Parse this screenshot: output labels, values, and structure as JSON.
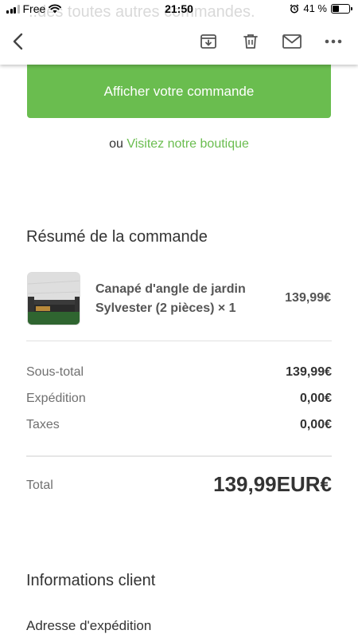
{
  "status_bar": {
    "carrier": "Free",
    "time": "21:50",
    "battery": "41 %",
    "battery_level": 0.41,
    "ghost_text": "..des toutes autres commandes."
  },
  "toolbar": {
    "back_icon": "chevron-left-icon",
    "archive_icon": "archive-icon",
    "delete_icon": "trash-icon",
    "mail_icon": "envelope-icon",
    "more_icon": "more-horizontal-icon"
  },
  "order": {
    "view_button": "Afficher votre commande",
    "or_text": "ou",
    "shop_link": "Visitez notre boutique"
  },
  "summary": {
    "title": "Résumé de la commande",
    "item": {
      "name": "Canapé d'angle de jardin Sylvester (2 pièces) × 1",
      "price": "139,99€"
    },
    "subtotal_label": "Sous-total",
    "subtotal_value": "139,99€",
    "shipping_label": "Expédition",
    "shipping_value": "0,00€",
    "taxes_label": "Taxes",
    "taxes_value": "0,00€",
    "total_label": "Total",
    "total_value": "139,99EUR€"
  },
  "customer": {
    "title": "Informations client",
    "shipping_address_label": "Adresse d'expédition"
  },
  "colors": {
    "accent": "#6abd4f",
    "text": "#333333",
    "muted": "#707070"
  }
}
